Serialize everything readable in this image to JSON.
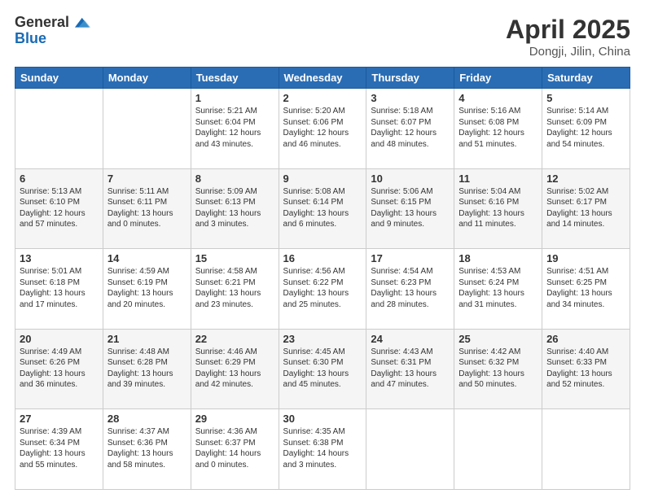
{
  "logo": {
    "general": "General",
    "blue": "Blue"
  },
  "header": {
    "title": "April 2025",
    "location": "Dongji, Jilin, China"
  },
  "weekdays": [
    "Sunday",
    "Monday",
    "Tuesday",
    "Wednesday",
    "Thursday",
    "Friday",
    "Saturday"
  ],
  "weeks": [
    [
      {
        "day": "",
        "text": ""
      },
      {
        "day": "",
        "text": ""
      },
      {
        "day": "1",
        "text": "Sunrise: 5:21 AM\nSunset: 6:04 PM\nDaylight: 12 hours and 43 minutes."
      },
      {
        "day": "2",
        "text": "Sunrise: 5:20 AM\nSunset: 6:06 PM\nDaylight: 12 hours and 46 minutes."
      },
      {
        "day": "3",
        "text": "Sunrise: 5:18 AM\nSunset: 6:07 PM\nDaylight: 12 hours and 48 minutes."
      },
      {
        "day": "4",
        "text": "Sunrise: 5:16 AM\nSunset: 6:08 PM\nDaylight: 12 hours and 51 minutes."
      },
      {
        "day": "5",
        "text": "Sunrise: 5:14 AM\nSunset: 6:09 PM\nDaylight: 12 hours and 54 minutes."
      }
    ],
    [
      {
        "day": "6",
        "text": "Sunrise: 5:13 AM\nSunset: 6:10 PM\nDaylight: 12 hours and 57 minutes."
      },
      {
        "day": "7",
        "text": "Sunrise: 5:11 AM\nSunset: 6:11 PM\nDaylight: 13 hours and 0 minutes."
      },
      {
        "day": "8",
        "text": "Sunrise: 5:09 AM\nSunset: 6:13 PM\nDaylight: 13 hours and 3 minutes."
      },
      {
        "day": "9",
        "text": "Sunrise: 5:08 AM\nSunset: 6:14 PM\nDaylight: 13 hours and 6 minutes."
      },
      {
        "day": "10",
        "text": "Sunrise: 5:06 AM\nSunset: 6:15 PM\nDaylight: 13 hours and 9 minutes."
      },
      {
        "day": "11",
        "text": "Sunrise: 5:04 AM\nSunset: 6:16 PM\nDaylight: 13 hours and 11 minutes."
      },
      {
        "day": "12",
        "text": "Sunrise: 5:02 AM\nSunset: 6:17 PM\nDaylight: 13 hours and 14 minutes."
      }
    ],
    [
      {
        "day": "13",
        "text": "Sunrise: 5:01 AM\nSunset: 6:18 PM\nDaylight: 13 hours and 17 minutes."
      },
      {
        "day": "14",
        "text": "Sunrise: 4:59 AM\nSunset: 6:19 PM\nDaylight: 13 hours and 20 minutes."
      },
      {
        "day": "15",
        "text": "Sunrise: 4:58 AM\nSunset: 6:21 PM\nDaylight: 13 hours and 23 minutes."
      },
      {
        "day": "16",
        "text": "Sunrise: 4:56 AM\nSunset: 6:22 PM\nDaylight: 13 hours and 25 minutes."
      },
      {
        "day": "17",
        "text": "Sunrise: 4:54 AM\nSunset: 6:23 PM\nDaylight: 13 hours and 28 minutes."
      },
      {
        "day": "18",
        "text": "Sunrise: 4:53 AM\nSunset: 6:24 PM\nDaylight: 13 hours and 31 minutes."
      },
      {
        "day": "19",
        "text": "Sunrise: 4:51 AM\nSunset: 6:25 PM\nDaylight: 13 hours and 34 minutes."
      }
    ],
    [
      {
        "day": "20",
        "text": "Sunrise: 4:49 AM\nSunset: 6:26 PM\nDaylight: 13 hours and 36 minutes."
      },
      {
        "day": "21",
        "text": "Sunrise: 4:48 AM\nSunset: 6:28 PM\nDaylight: 13 hours and 39 minutes."
      },
      {
        "day": "22",
        "text": "Sunrise: 4:46 AM\nSunset: 6:29 PM\nDaylight: 13 hours and 42 minutes."
      },
      {
        "day": "23",
        "text": "Sunrise: 4:45 AM\nSunset: 6:30 PM\nDaylight: 13 hours and 45 minutes."
      },
      {
        "day": "24",
        "text": "Sunrise: 4:43 AM\nSunset: 6:31 PM\nDaylight: 13 hours and 47 minutes."
      },
      {
        "day": "25",
        "text": "Sunrise: 4:42 AM\nSunset: 6:32 PM\nDaylight: 13 hours and 50 minutes."
      },
      {
        "day": "26",
        "text": "Sunrise: 4:40 AM\nSunset: 6:33 PM\nDaylight: 13 hours and 52 minutes."
      }
    ],
    [
      {
        "day": "27",
        "text": "Sunrise: 4:39 AM\nSunset: 6:34 PM\nDaylight: 13 hours and 55 minutes."
      },
      {
        "day": "28",
        "text": "Sunrise: 4:37 AM\nSunset: 6:36 PM\nDaylight: 13 hours and 58 minutes."
      },
      {
        "day": "29",
        "text": "Sunrise: 4:36 AM\nSunset: 6:37 PM\nDaylight: 14 hours and 0 minutes."
      },
      {
        "day": "30",
        "text": "Sunrise: 4:35 AM\nSunset: 6:38 PM\nDaylight: 14 hours and 3 minutes."
      },
      {
        "day": "",
        "text": ""
      },
      {
        "day": "",
        "text": ""
      },
      {
        "day": "",
        "text": ""
      }
    ]
  ]
}
